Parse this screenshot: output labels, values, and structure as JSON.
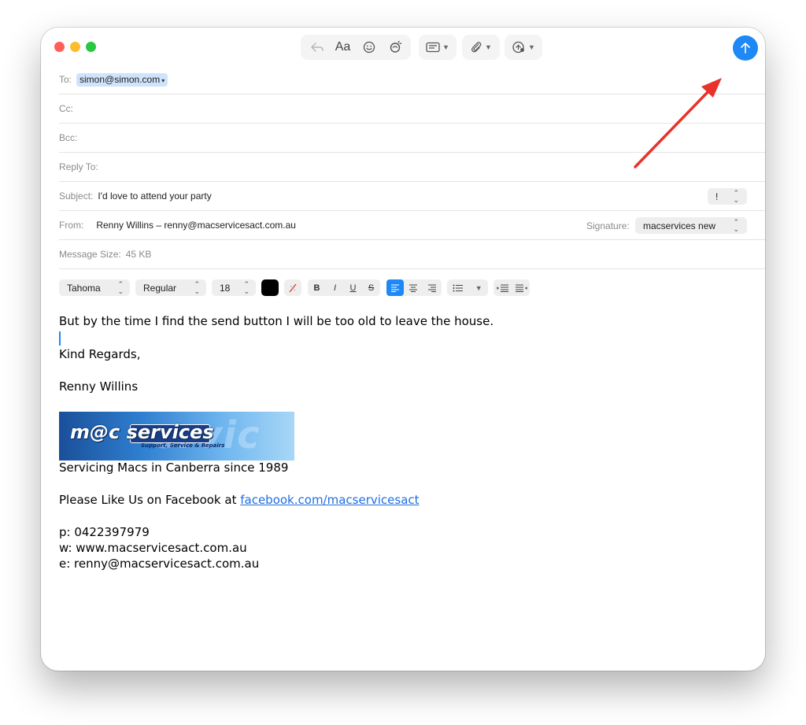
{
  "toolbar": {
    "reply_icon": "reply-arrow-icon",
    "format_label": "Aa",
    "emoji_icon": "emoji-icon",
    "photo_icon": "photo-effects-icon",
    "header_fields_icon": "header-fields-icon",
    "attach_icon": "paperclip-icon",
    "markup_icon": "markup-icon",
    "send_icon": "send-arrow-icon"
  },
  "header": {
    "to_label": "To:",
    "to_recipient": "simon@simon.com",
    "cc_label": "Cc:",
    "bcc_label": "Bcc:",
    "reply_to_label": "Reply To:",
    "subject_label": "Subject:",
    "subject_value": "I'd love to attend your party",
    "priority_label": "!",
    "from_label": "From:",
    "from_value": "Renny Willins – renny@macservicesact.com.au",
    "signature_label": "Signature:",
    "signature_value": "macservices new",
    "size_label": "Message Size:",
    "size_value": "45 KB"
  },
  "format_bar": {
    "font": "Tahoma",
    "style": "Regular",
    "size": "18",
    "bold": "B",
    "italic": "I",
    "underline": "U",
    "strike": "S",
    "text_color": "#000000",
    "align_active": "left"
  },
  "message": {
    "line1": "But by the time I find the send button I will be too old to leave the house.",
    "greeting": "Kind Regards,",
    "name": "Renny Willins",
    "logo_text": "m@c services",
    "logo_tagline": "Support, Service & Repairs",
    "tagline": "Servicing Macs in Canberra since 1989",
    "facebook_prefix": "Please Like Us on Facebook at ",
    "facebook_link": "facebook.com/macservicesact",
    "phone": "p: 0422397979",
    "web": "w: www.macservicesact.com.au",
    "email": "e: renny@macservicesact.com.au"
  },
  "colors": {
    "accent": "#1e88f7",
    "annotation_arrow": "#e8322b"
  }
}
